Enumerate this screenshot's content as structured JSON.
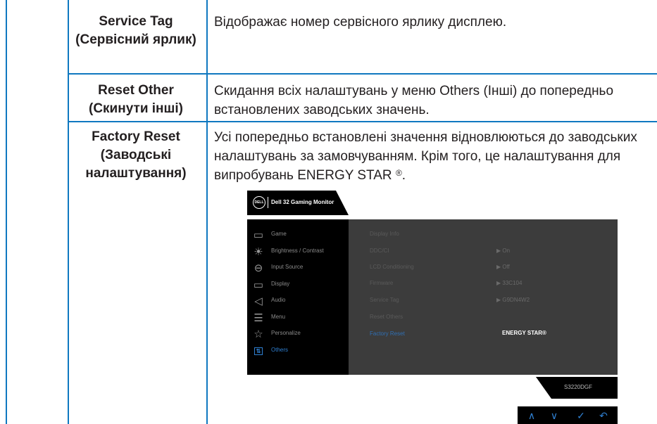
{
  "rows": [
    {
      "label": "Service Tag (Сервісний ярлик)",
      "description": "Відображає номер сервісного ярлику дисплею."
    },
    {
      "label": "Reset Other (Скинути інші)",
      "description": "Скидання всіх налаштувань у меню Others (Інші)  до попередньо встановлених заводських значень."
    },
    {
      "label": "Factory Reset (Заводські налаштування)",
      "description": "Усі попередньо встановлені значення відновлюються до заводських налаштувань за замовчуванням. Крім того, це налаштування для випробувань ENERGY STAR",
      "description_mark": "®",
      "description_end": "."
    }
  ],
  "osd": {
    "brand": "DELL",
    "title": "Dell 32 Gaming Monitor",
    "menu": [
      {
        "label": "Game",
        "icon": "game-icon"
      },
      {
        "label": "Brightness / Contrast",
        "icon": "brightness-icon"
      },
      {
        "label": "Input Source",
        "icon": "input-source-icon"
      },
      {
        "label": "Display",
        "icon": "display-icon"
      },
      {
        "label": "Audio",
        "icon": "audio-icon"
      },
      {
        "label": "Menu",
        "icon": "menu-icon"
      },
      {
        "label": "Personalize",
        "icon": "star-icon"
      },
      {
        "label": "Others",
        "icon": "others-icon",
        "active": true
      }
    ],
    "submenu": [
      {
        "label": "Display Info",
        "value": ""
      },
      {
        "label": "DDC/CI",
        "value": "▶  On"
      },
      {
        "label": "LCD Conditioning",
        "value": "▶  Off"
      },
      {
        "label": "Firmware",
        "value": "▶  33C104"
      },
      {
        "label": "Service Tag",
        "value": "▶  G9DN4W2"
      },
      {
        "label": "Reset Others",
        "value": ""
      },
      {
        "label": "Factory Reset",
        "value": "ENERGY STAR®",
        "active": true
      }
    ],
    "model": "S3220DGF",
    "nav": [
      "∧",
      "∨",
      "✓",
      "↶"
    ],
    "colors": {
      "accent": "#2f7fd0",
      "panel": "#3c3c3c",
      "rule": "#0f78c0"
    }
  }
}
